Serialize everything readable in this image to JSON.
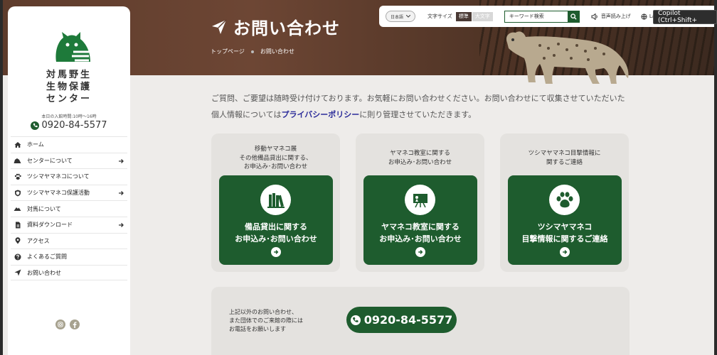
{
  "hero": {
    "title": "お問い合わせ",
    "breadcrumb": [
      "トップページ",
      "お問い合わせ"
    ]
  },
  "toolbar": {
    "language_select": "日本語",
    "font_size_label": "文字サイズ",
    "font_size_standard": "標準",
    "font_size_large": "大文字",
    "search_placeholder": "キーワード検索",
    "read_aloud": "音声読み上げ",
    "language_link": "Lan"
  },
  "overlay": {
    "copilot_tooltip": "Copilot (Ctrl+Shift+"
  },
  "sidebar": {
    "org_name_lines": [
      "対馬野生",
      "生物保護",
      "センター"
    ],
    "hours": "本日の入館時間:10時～16時",
    "phone": "0920-84-5577",
    "nav": [
      {
        "label": "ホーム",
        "icon": "home-icon",
        "has_arrow": false
      },
      {
        "label": "センターについて",
        "icon": "building-icon",
        "has_arrow": true
      },
      {
        "label": "ツシマヤマネコについて",
        "icon": "paw-icon",
        "has_arrow": false
      },
      {
        "label": "ツシマヤマネコ保護活動",
        "icon": "shield-icon",
        "has_arrow": true
      },
      {
        "label": "対馬について",
        "icon": "mountain-icon",
        "has_arrow": false
      },
      {
        "label": "資料ダウンロード",
        "icon": "download-icon",
        "has_arrow": true
      },
      {
        "label": "アクセス",
        "icon": "map-pin-icon",
        "has_arrow": false
      },
      {
        "label": "よくあるご質問",
        "icon": "question-icon",
        "has_arrow": false
      },
      {
        "label": "お問い合わせ",
        "icon": "paper-plane-icon",
        "has_arrow": false
      }
    ],
    "social": [
      "instagram-icon",
      "facebook-icon"
    ]
  },
  "main": {
    "intro_line1": "ご質問、ご要望は随時受け付けております。お気軽にお問い合わせください。お問い合わせにて収集させていただいた",
    "intro_line2_pre": "個人情報については",
    "intro_link": "プライバシーポリシー",
    "intro_line2_post": "に則り管理させていただきます。",
    "cards": [
      {
        "caption": [
          "移動ヤマネコ展",
          "その他備品貸出に関する、",
          "お申込み･お問い合わせ"
        ],
        "button": [
          "備品貸出に関する",
          "お申込み･お問い合わせ"
        ],
        "icon": "books-icon"
      },
      {
        "caption": [
          "ヤマネコ教室に関する",
          "お申込み･お問い合わせ"
        ],
        "button": [
          "ヤマネコ教室に関する",
          "お申込み･お問い合わせ"
        ],
        "icon": "blackboard-icon"
      },
      {
        "caption": [
          "ツシマヤマネコ目撃情報に",
          "関するご連絡"
        ],
        "button": [
          "ツシマヤマネコ",
          "目撃情報に関するご連絡"
        ],
        "icon": "paw-icon"
      }
    ],
    "contact_text": [
      "上記以外のお問い合わせ、",
      "また団体でのご来館の際には",
      "お電話をお願いします"
    ],
    "contact_phone": "0920-84-5577"
  },
  "colors": {
    "brand_green": "#1e5c2e",
    "hero_brown": "#5e3c2c",
    "page_bg": "#eeecea"
  }
}
